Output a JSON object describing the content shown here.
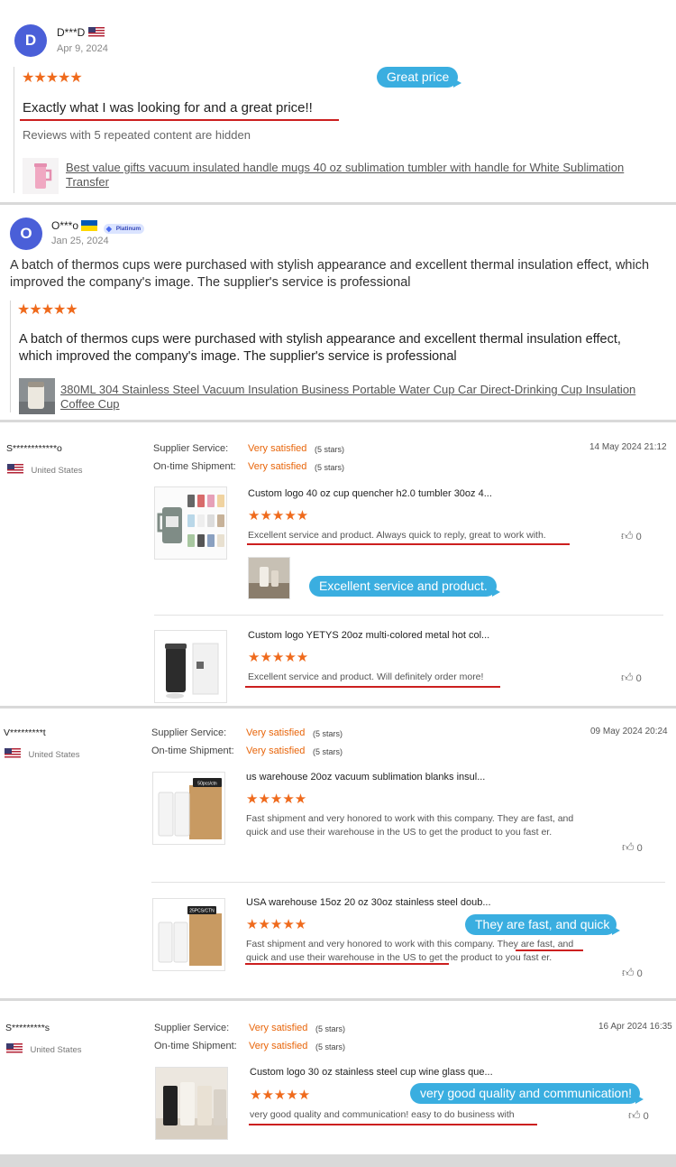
{
  "review1": {
    "avatar_letter": "D",
    "user": "D***D",
    "date": "Apr 9, 2024",
    "stars": "★★★★★",
    "text": "Exactly what I was looking for and a great price!!",
    "hidden_note": "Reviews with 5 repeated content are hidden",
    "product": "Best value gifts vacuum insulated handle mugs 40 oz sublimation tumbler with handle for White Sublimation Transfer",
    "bubble": "Great price"
  },
  "review2": {
    "avatar_letter": "O",
    "user": "O***o",
    "badge": "Platinum",
    "date": "Jan 25, 2024",
    "summary": "A batch of thermos cups were purchased with stylish appearance and excellent thermal insulation effect, which improved the company's image. The supplier's service is professional",
    "stars": "★★★★★",
    "text": "A batch of thermos cups were purchased with stylish appearance and excellent thermal insulation effect, which improved the company's image. The supplier's service is professional",
    "product": "380ML 304 Stainless Steel Vacuum Insulation Business Portable Water Cup Car Direct-Drinking Cup Insulation Coffee Cup"
  },
  "labels": {
    "supplier_service": "Supplier Service:",
    "ontime": "On-time Shipment:",
    "very_satisfied": "Very satisfied",
    "five_stars": "(5 stars)",
    "country": "United States"
  },
  "review3": {
    "user": "S************o",
    "date": "14 May 2024 21:12",
    "items": [
      {
        "title": "Custom logo 40 oz cup quencher h2.0 tumbler 30oz 4...",
        "stars": "★★★★★",
        "comment": "Excellent service and product. Always quick to reply, great to work with.",
        "likes": "0"
      },
      {
        "title": "Custom logo YETYS 20oz multi-colored metal hot col...",
        "stars": "★★★★★",
        "comment": "Excellent service and product. Will definitely order more!",
        "likes": "0"
      }
    ],
    "bubble": "Excellent service and product."
  },
  "review4": {
    "user": "V*********t",
    "date": "09 May 2024 20:24",
    "items": [
      {
        "title": "us warehouse 20oz vacuum sublimation blanks insul...",
        "stars": "★★★★★",
        "comment": "Fast shipment and very honored to work with this company. They are fast, and quick and use their warehouse in the US to get the product to you fast er.",
        "likes": "0",
        "box_label": "50pcs/ctn"
      },
      {
        "title": "USA warehouse 15oz 20 oz 30oz stainless steel doub...",
        "stars": "★★★★★",
        "comment": "Fast shipment and very honored to work with this company. They are fast, and quick and use their warehouse in the US to get the product to you fast er.",
        "likes": "0",
        "box_label": "25PCS/CTN"
      }
    ],
    "bubble": "They are fast, and quick"
  },
  "review5": {
    "user": "S*********s",
    "date": "16 Apr 2024 16:35",
    "items": [
      {
        "title": "Custom logo 30 oz stainless steel cup wine glass que...",
        "stars": "★★★★★",
        "comment": "very good quality and communication! easy to do business with",
        "likes": "0"
      }
    ],
    "bubble": "very good quality and communication!"
  },
  "colors": {
    "star": "#ef6a1c",
    "bubble": "#3aaee0",
    "avatar": "#4a5fd8",
    "satisfied": "#e8650a",
    "underline": "#cc1f1f"
  }
}
